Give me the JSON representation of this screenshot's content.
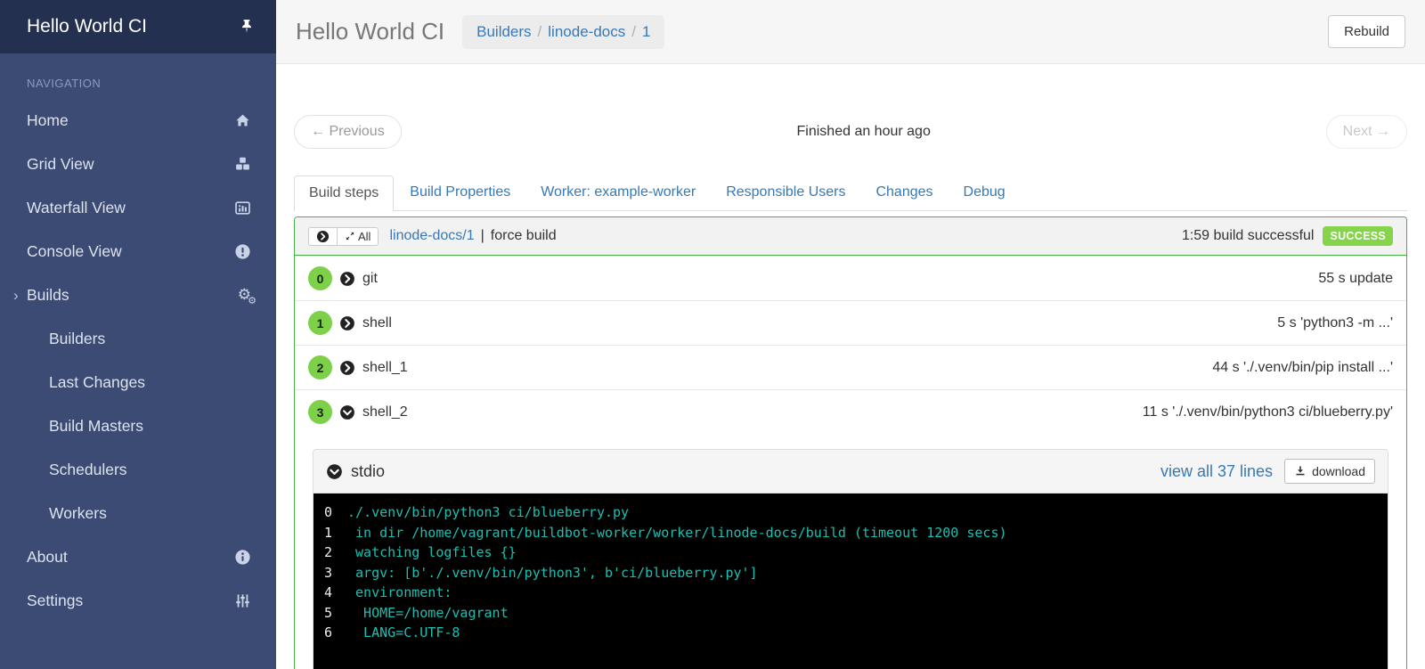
{
  "colors": {
    "sidebar_header_bg": "#24304F",
    "sidebar_bg": "#3C4B73",
    "sidebar_text": "#DDE3F0",
    "nav_label": "#8C9ABE",
    "header_bg": "#F6F6F6",
    "title_gray": "#777777",
    "link_blue": "#3779B5",
    "panel_green": "#4CAE4C",
    "badge_green": "#86D34C",
    "circle_green": "#7CD148",
    "terminal_bg": "#000000",
    "terminal_text": "#1AC0B2",
    "terminal_line_number": "#EEEEEE"
  },
  "sidebar": {
    "title": "Hello World CI",
    "nav_label": "NAVIGATION",
    "items": [
      {
        "label": "Home",
        "icon": "home-icon"
      },
      {
        "label": "Grid View",
        "icon": "cubes-icon"
      },
      {
        "label": "Waterfall View",
        "icon": "bar-chart-icon"
      },
      {
        "label": "Console View",
        "icon": "exclamation-circle-icon"
      },
      {
        "label": "Builds",
        "icon": "gears-icon",
        "expanded": true
      },
      {
        "label": "About",
        "icon": "info-circle-icon"
      },
      {
        "label": "Settings",
        "icon": "sliders-icon"
      }
    ],
    "builds_children": [
      "Builders",
      "Last Changes",
      "Build Masters",
      "Schedulers",
      "Workers"
    ],
    "builds_caret": "›",
    "gear_glyph": "⚙"
  },
  "header": {
    "title": "Hello World CI",
    "breadcrumb": {
      "items": [
        "Builders",
        "linode-docs",
        "1"
      ],
      "separator": "/"
    },
    "rebuild_label": "Rebuild"
  },
  "pager": {
    "previous_label": "← Previous",
    "status_text": "Finished an hour ago",
    "next_label": "Next →"
  },
  "tabs": [
    {
      "label": "Build steps",
      "active": true
    },
    {
      "label": "Build Properties",
      "active": false
    },
    {
      "label": "Worker: example-worker",
      "active": false
    },
    {
      "label": "Responsible Users",
      "active": false
    },
    {
      "label": "Changes",
      "active": false
    },
    {
      "label": "Debug",
      "active": false
    }
  ],
  "build_summary": {
    "all_toggle_label": "All",
    "build_link": "linode-docs/1",
    "separator": "|",
    "reason": "force build",
    "status_text": "1:59 build successful",
    "badge": "SUCCESS"
  },
  "steps": [
    {
      "number": "0",
      "name": "git",
      "detail": "55 s update"
    },
    {
      "number": "1",
      "name": "shell",
      "detail": "5 s 'python3 -m ...'"
    },
    {
      "number": "2",
      "name": "shell_1",
      "detail": "44 s './.venv/bin/pip install ...'"
    },
    {
      "number": "3",
      "name": "shell_2",
      "detail": "11 s './.venv/bin/python3 ci/blueberry.py'"
    }
  ],
  "stdio": {
    "title": "stdio",
    "view_all_label": "view all 37 lines",
    "download_label": "download"
  },
  "terminal": {
    "lines": [
      {
        "n": "0",
        "text": "./.venv/bin/python3 ci/blueberry.py"
      },
      {
        "n": "1",
        "text": " in dir /home/vagrant/buildbot-worker/worker/linode-docs/build (timeout 1200 secs)"
      },
      {
        "n": "2",
        "text": " watching logfiles {}"
      },
      {
        "n": "3",
        "text": " argv: [b'./.venv/bin/python3', b'ci/blueberry.py']"
      },
      {
        "n": "4",
        "text": " environment:"
      },
      {
        "n": "5",
        "text": "  HOME=/home/vagrant"
      },
      {
        "n": "6",
        "text": "  LANG=C.UTF-8"
      }
    ]
  }
}
